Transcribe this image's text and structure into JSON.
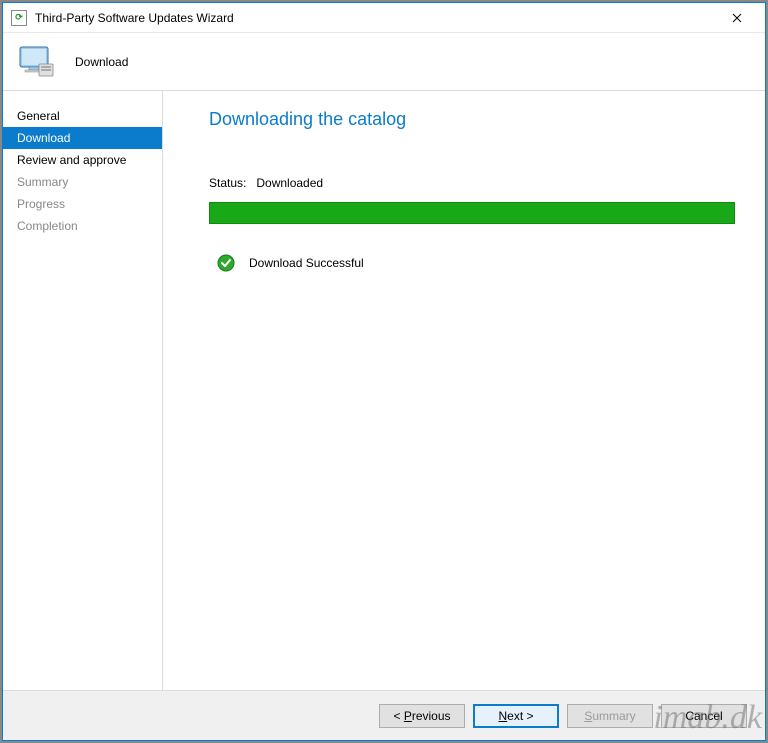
{
  "window": {
    "title": "Third-Party Software Updates Wizard"
  },
  "header": {
    "section_label": "Download"
  },
  "sidebar": {
    "items": [
      {
        "label": "General",
        "enabled": true,
        "active": false
      },
      {
        "label": "Download",
        "enabled": true,
        "active": true
      },
      {
        "label": "Review and approve",
        "enabled": true,
        "active": false
      },
      {
        "label": "Summary",
        "enabled": false,
        "active": false
      },
      {
        "label": "Progress",
        "enabled": false,
        "active": false
      },
      {
        "label": "Completion",
        "enabled": false,
        "active": false
      }
    ]
  },
  "content": {
    "heading": "Downloading the catalog",
    "status_label": "Status:",
    "status_value": "Downloaded",
    "result_text": "Download Successful",
    "progress_percent": 100
  },
  "footer": {
    "previous": "Previous",
    "next": "Next >",
    "summary": "Summary",
    "cancel": "Cancel"
  },
  "watermark": "imab.dk"
}
